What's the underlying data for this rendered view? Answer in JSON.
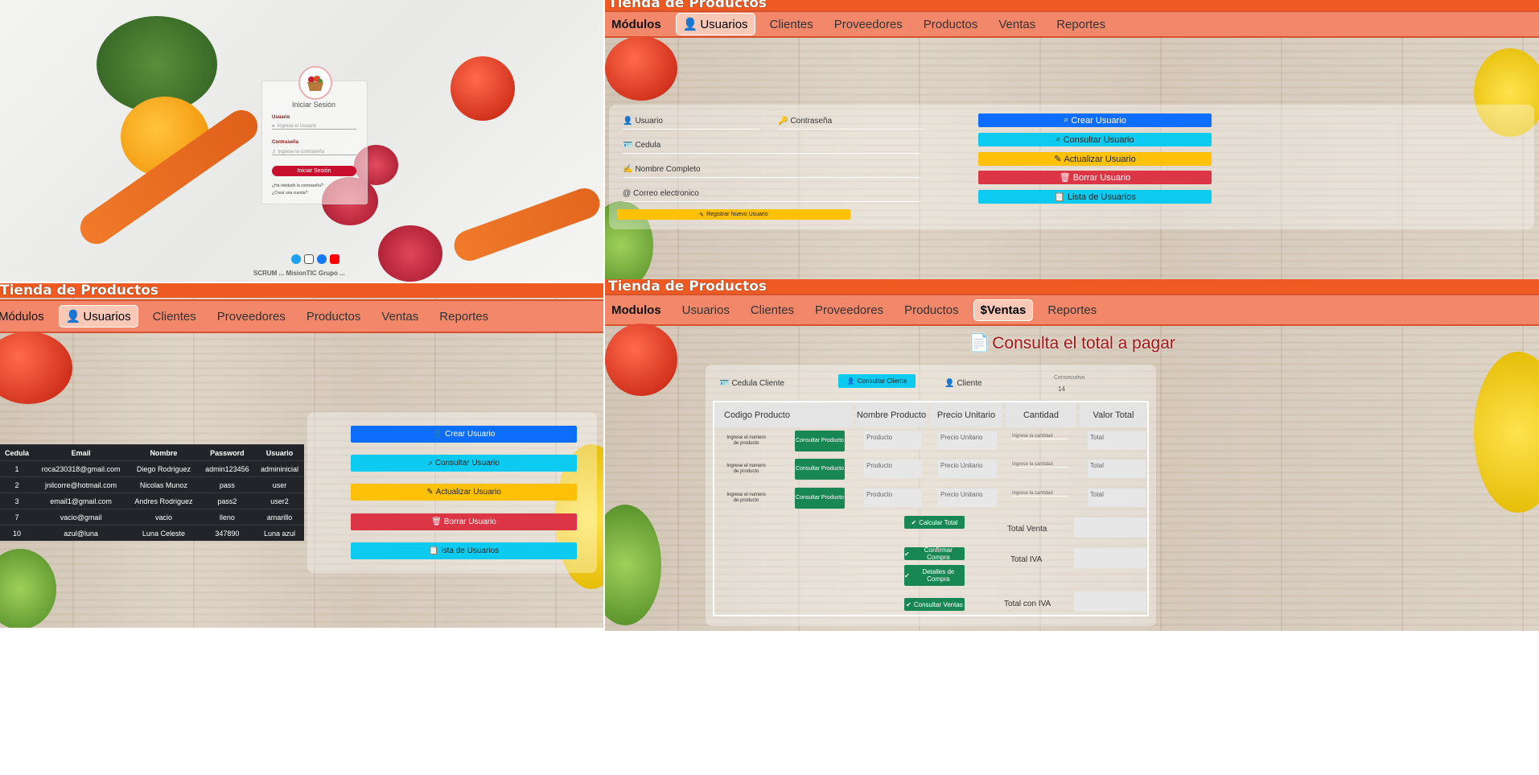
{
  "login": {
    "title": "Iniciar Sesión",
    "user_label": "Usuario",
    "user_placeholder": "Ingrese el Usuario",
    "pass_label": "Contraseña",
    "pass_placeholder": "Ingrese la contraseña",
    "submit": "Iniciar Sesión",
    "link1": "¿Ha olvidado la contraseña?",
    "link2": "¿Crear una cuenta?",
    "footer": "SCRUM ... MisionTIC Grupo ...",
    "social_icons": [
      "twitter-icon",
      "instagram-icon",
      "facebook-icon",
      "youtube-icon"
    ]
  },
  "header": {
    "store_title": "Tienda de Productos"
  },
  "nav": {
    "brand": "Módulos",
    "brand_alt": "Modulos",
    "usuarios": "Usuarios",
    "clientes": "Clientes",
    "proveedores": "Proveedores",
    "productos": "Productos",
    "ventas": "Ventas",
    "ventas_active": "$Ventas",
    "reportes": "Reportes"
  },
  "user_form": {
    "usuario": "Usuario",
    "contrasena": "Contraseña",
    "cedula": "Cedula",
    "nombre": "Nombre Completo",
    "correo": "Correo electronico",
    "registrar": "Registrar Nuevo Usuario"
  },
  "user_actions": {
    "crear": "Crear Usuario",
    "consultar": "Consultar Usuario",
    "actualizar": "Actualizar Usuario",
    "borrar": "Borrar Usuario",
    "lista": "Lista de Usuarios",
    "lista_alt": "ista de Usuarios"
  },
  "users_table": {
    "headers": [
      "Cedula",
      "Email",
      "Nombre",
      "Password",
      "Usuario"
    ],
    "rows": [
      [
        "1",
        "roca230318@gmail.com",
        "Diego Rodriguez",
        "admin123456",
        "admininicial"
      ],
      [
        "2",
        "jnilcorre@hotmail.com",
        "Nicolas Munoz",
        "pass",
        "user"
      ],
      [
        "3",
        "email1@gmail.com",
        "Andres Rodriguez",
        "pass2",
        "user2"
      ],
      [
        "7",
        "vacio@gmail",
        "vacio",
        "lleno",
        "amarillo"
      ],
      [
        "10",
        "azul@luna",
        "Luna Celeste",
        "347890",
        "Luna azul"
      ]
    ]
  },
  "ventas": {
    "title": "Consulta el total a pagar",
    "cedula_cliente": "Cedula Cliente",
    "consultar_cliente": "Consultar Cliente",
    "cliente": "Cliente",
    "consecutivo_label": "Consecutivo",
    "consecutivo_value": "14",
    "headers": [
      "Codigo Producto",
      "Nombre Producto",
      "Precio Unitario",
      "Cantidad",
      "Valor Total"
    ],
    "row_placeholders": {
      "codigo": "Ingrese el numero de producto",
      "consultar": "Consultar Producto",
      "producto": "Producto",
      "precio": "Precio Unitario",
      "cantidad": "Ingrese la cantidad",
      "total": "Total"
    },
    "calcular_total": "Calcular Total",
    "confirmar_compra": "Confirmar Compra",
    "detalles_compra": "Detalles de Compra",
    "consultar_ventas": "Consultar Ventas",
    "total_venta": "Total Venta",
    "total_iva": "Total IVA",
    "total_con_iva": "Total con IVA"
  }
}
